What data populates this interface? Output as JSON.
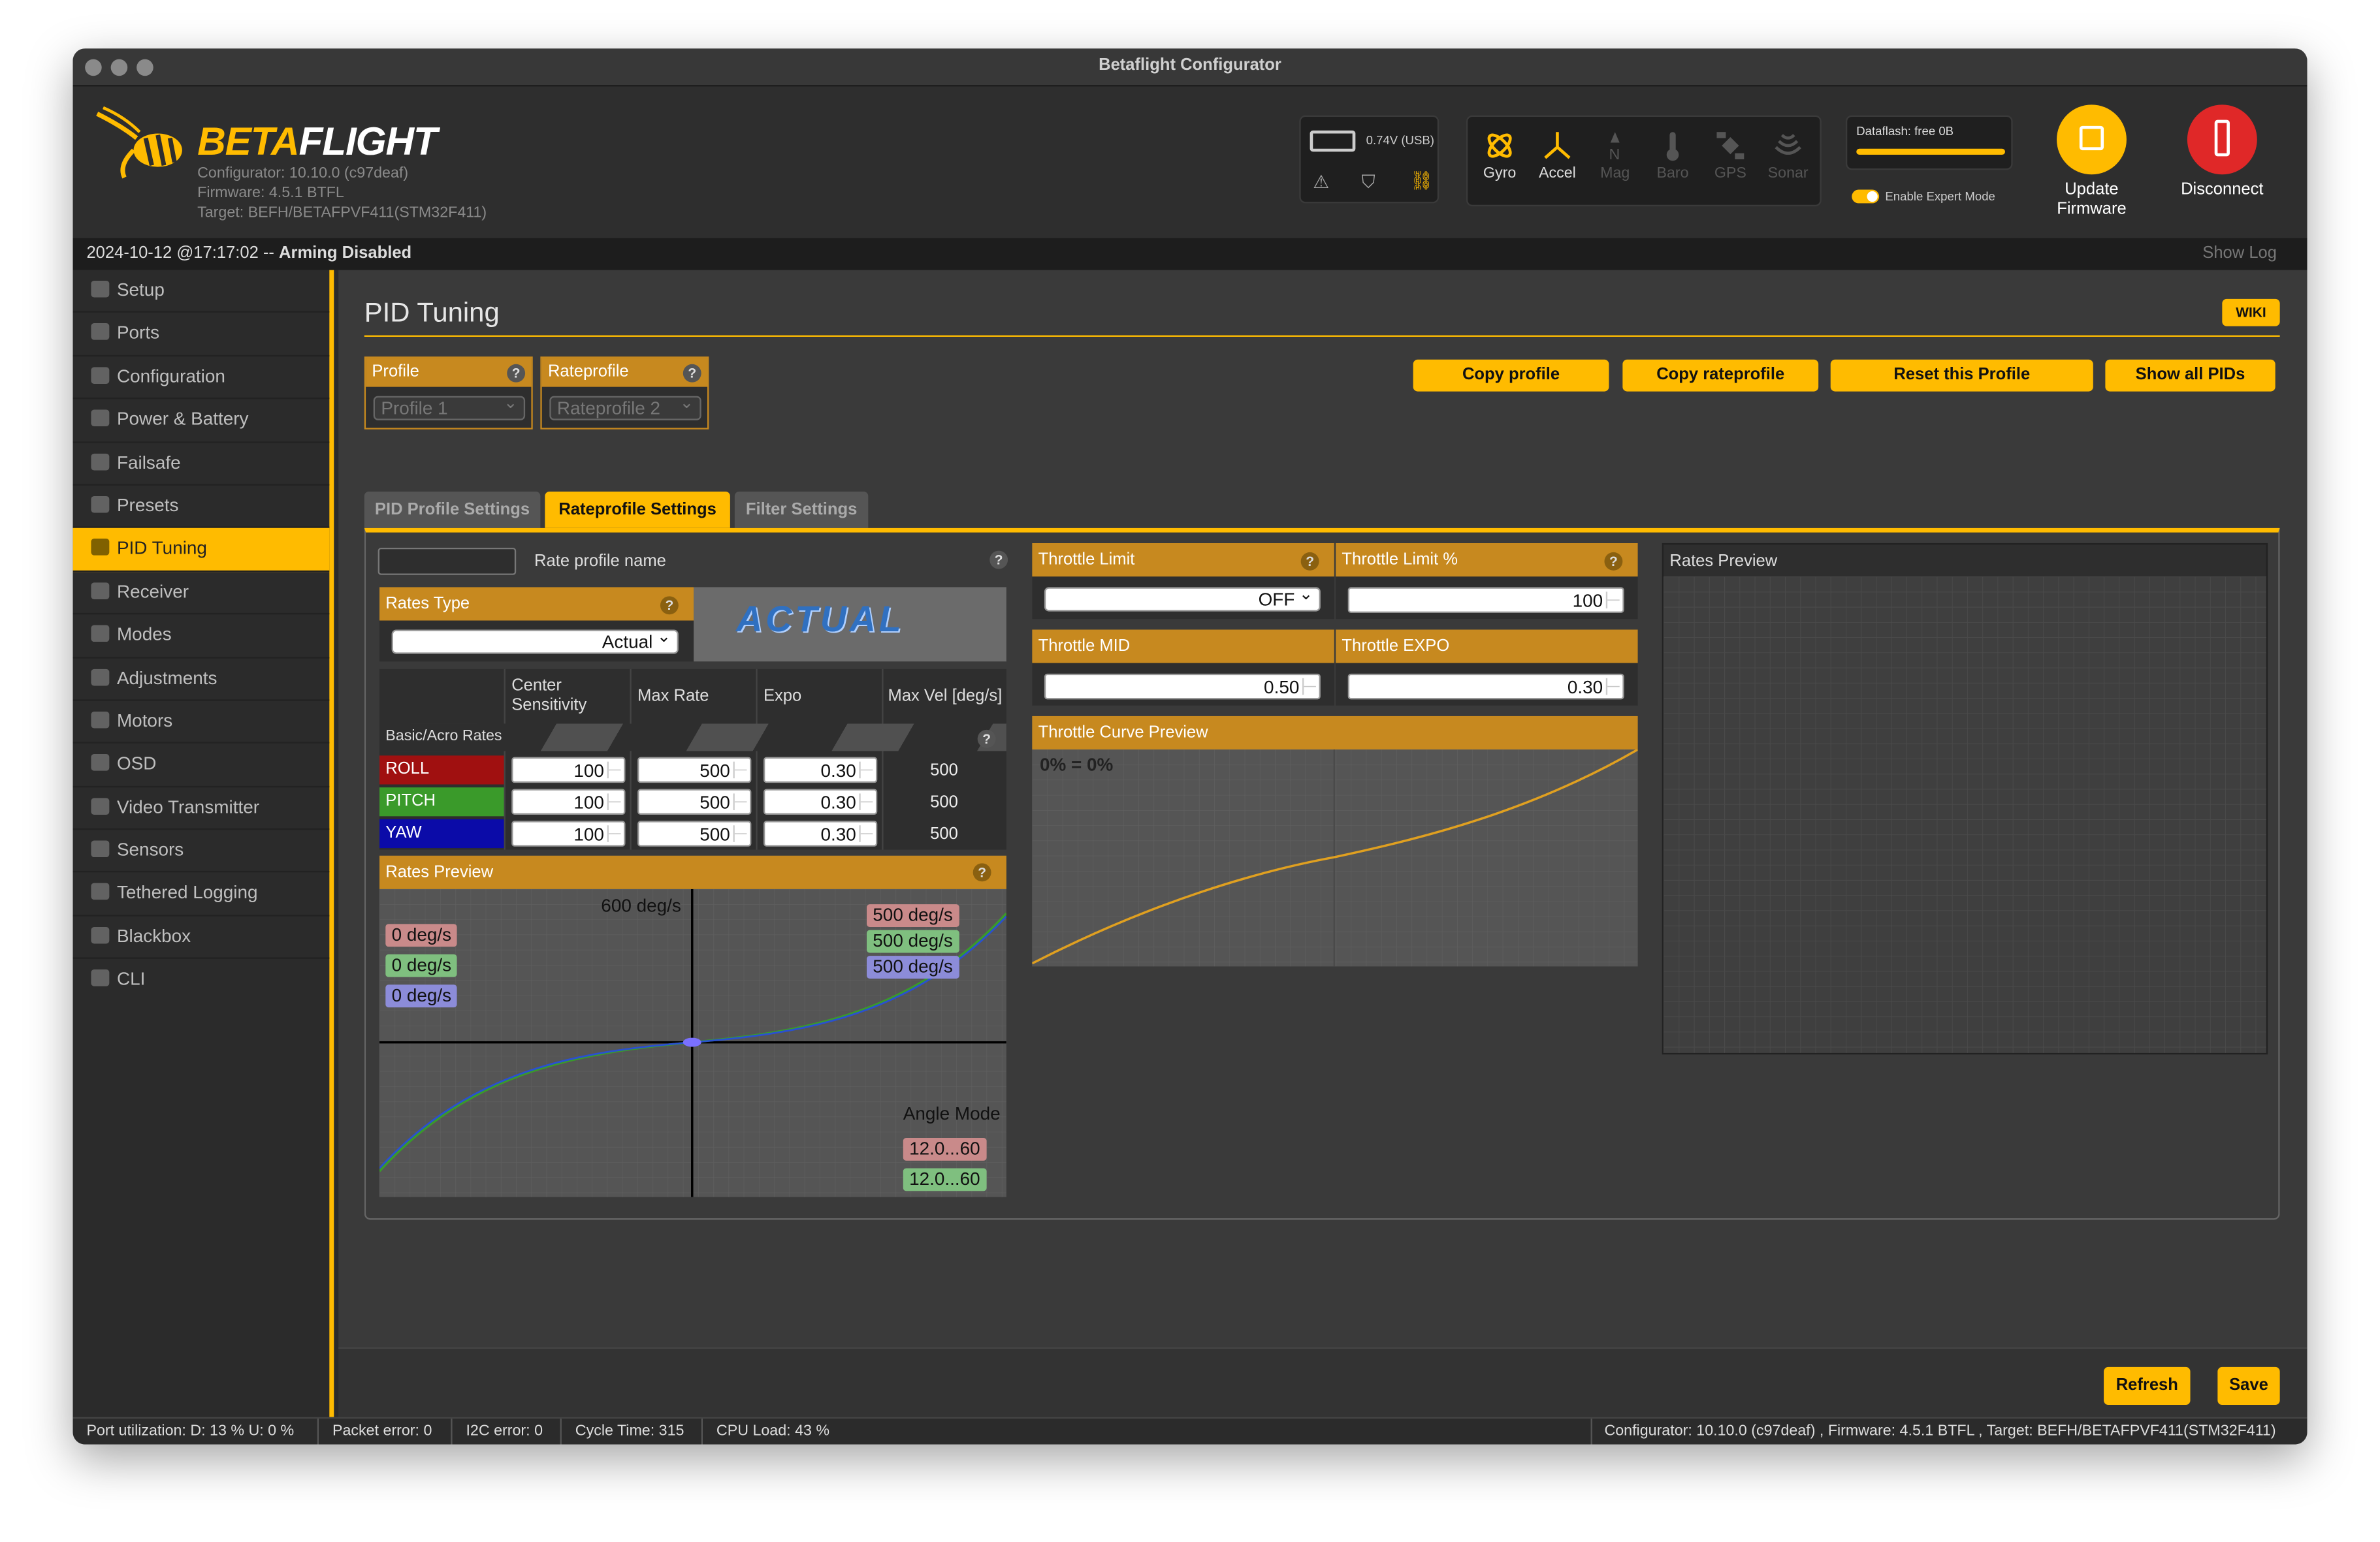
{
  "window": {
    "title": "Betaflight Configurator"
  },
  "header": {
    "brand_part1": "BETA",
    "brand_part2": "FLIGHT",
    "configurator_version": "Configurator: 10.10.0 (c97deaf)",
    "firmware_version": "Firmware: 4.5.1 BTFL",
    "target": "Target: BEFH/BETAFPVF411(STM32F411)",
    "battery_voltage": "0.74V (USB)",
    "sensors": [
      {
        "label": "Gyro",
        "active": true,
        "icon": "gyro-icon"
      },
      {
        "label": "Accel",
        "active": true,
        "icon": "accel-icon"
      },
      {
        "label": "Mag",
        "active": false,
        "icon": "mag-icon"
      },
      {
        "label": "Baro",
        "active": false,
        "icon": "baro-icon"
      },
      {
        "label": "GPS",
        "active": false,
        "icon": "gps-icon"
      },
      {
        "label": "Sonar",
        "active": false,
        "icon": "sonar-icon"
      }
    ],
    "dataflash": "Dataflash: free 0B",
    "expert_mode_label": "Enable Expert Mode",
    "expert_mode_on": true,
    "update_firmware_line1": "Update",
    "update_firmware_line2": "Firmware",
    "disconnect_label": "Disconnect"
  },
  "status": {
    "datetime": "2024-10-12 @17:17:02 -- ",
    "arming": "Arming Disabled",
    "show_log": "Show Log"
  },
  "sidebar": {
    "items": [
      {
        "label": "Setup",
        "icon": "wrench-icon"
      },
      {
        "label": "Ports",
        "icon": "plug-icon"
      },
      {
        "label": "Configuration",
        "icon": "gear-icon"
      },
      {
        "label": "Power & Battery",
        "icon": "battery-icon"
      },
      {
        "label": "Failsafe",
        "icon": "parachute-icon"
      },
      {
        "label": "Presets",
        "icon": "presets-icon"
      },
      {
        "label": "PID Tuning",
        "icon": "pid-icon",
        "active": true
      },
      {
        "label": "Receiver",
        "icon": "receiver-icon"
      },
      {
        "label": "Modes",
        "icon": "modes-icon"
      },
      {
        "label": "Adjustments",
        "icon": "sliders-icon"
      },
      {
        "label": "Motors",
        "icon": "motor-icon"
      },
      {
        "label": "OSD",
        "icon": "osd-icon"
      },
      {
        "label": "Video Transmitter",
        "icon": "vtx-icon"
      },
      {
        "label": "Sensors",
        "icon": "sensors-icon"
      },
      {
        "label": "Tethered Logging",
        "icon": "logging-icon"
      },
      {
        "label": "Blackbox",
        "icon": "blackbox-icon"
      },
      {
        "label": "CLI",
        "icon": "cli-icon"
      }
    ]
  },
  "page": {
    "title": "PID Tuning",
    "wiki": "WIKI",
    "profile_label": "Profile",
    "profile_value": "Profile 1",
    "rateprofile_label": "Rateprofile",
    "rateprofile_value": "Rateprofile 2",
    "buttons": {
      "copy_profile": "Copy profile",
      "copy_rateprofile": "Copy rateprofile",
      "reset_profile": "Reset this Profile",
      "show_all_pids": "Show all PIDs"
    },
    "tabs": [
      "PID Profile Settings",
      "Rateprofile Settings",
      "Filter Settings"
    ],
    "active_tab": 1,
    "rate_profile_name_label": "Rate profile name",
    "rate_profile_name_value": "",
    "rates_type_label": "Rates Type",
    "rates_type_value": "Actual",
    "rates_logo_text": "ACTUAL",
    "table_headers": [
      "Center Sensitivity",
      "Max Rate",
      "Expo",
      "Max Vel [deg/s]"
    ],
    "table_headers_split": {
      "center1": "Center",
      "center2": "Sensitivity"
    },
    "basic_acro_label": "Basic/Acro Rates",
    "axes": [
      {
        "name": "ROLL",
        "color": "#a01010",
        "center": "100",
        "max_rate": "500",
        "expo": "0.30",
        "max_vel": "500"
      },
      {
        "name": "PITCH",
        "color": "#3a9a2a",
        "center": "100",
        "max_rate": "500",
        "expo": "0.30",
        "max_vel": "500"
      },
      {
        "name": "YAW",
        "color": "#0b0ba8",
        "center": "100",
        "max_rate": "500",
        "expo": "0.30",
        "max_vel": "500"
      }
    ],
    "rates_preview_label": "Rates Preview",
    "rates_preview_top_label": "600 deg/s",
    "rates_preview_current": [
      "0 deg/s",
      "0 deg/s",
      "0 deg/s"
    ],
    "rates_preview_max": [
      "500 deg/s",
      "500 deg/s",
      "500 deg/s"
    ],
    "angle_mode_label": "Angle Mode",
    "angle_mode_values": [
      "12.0...60",
      "12.0...60"
    ],
    "throttle_limit_label": "Throttle Limit",
    "throttle_limit_value": "OFF",
    "throttle_limit_pct_label": "Throttle Limit %",
    "throttle_limit_pct_value": "100",
    "throttle_mid_label": "Throttle MID",
    "throttle_mid_value": "0.50",
    "throttle_expo_label": "Throttle EXPO",
    "throttle_expo_value": "0.30",
    "throttle_curve_label": "Throttle Curve Preview",
    "throttle_curve_readout": "0% = 0%",
    "rates_preview_3d_label": "Rates Preview",
    "refresh": "Refresh",
    "save": "Save"
  },
  "footer": {
    "port_util": "Port utilization: D: 13 % U: 0 %",
    "packet_error": "Packet error: 0",
    "i2c_error": "I2C error: 0",
    "cycle_time": "Cycle Time: 315",
    "cpu_load": "CPU Load: 43 %",
    "versions": "Configurator: 10.10.0 (c97deaf) , Firmware: 4.5.1 BTFL , Target: BEFH/BETAFPVF411(STM32F411)"
  },
  "colors": {
    "accent": "#ffbb00",
    "panel_header": "#c7891f",
    "roll": "#a01010",
    "pitch": "#3a9a2a",
    "yaw": "#0b0ba8"
  }
}
